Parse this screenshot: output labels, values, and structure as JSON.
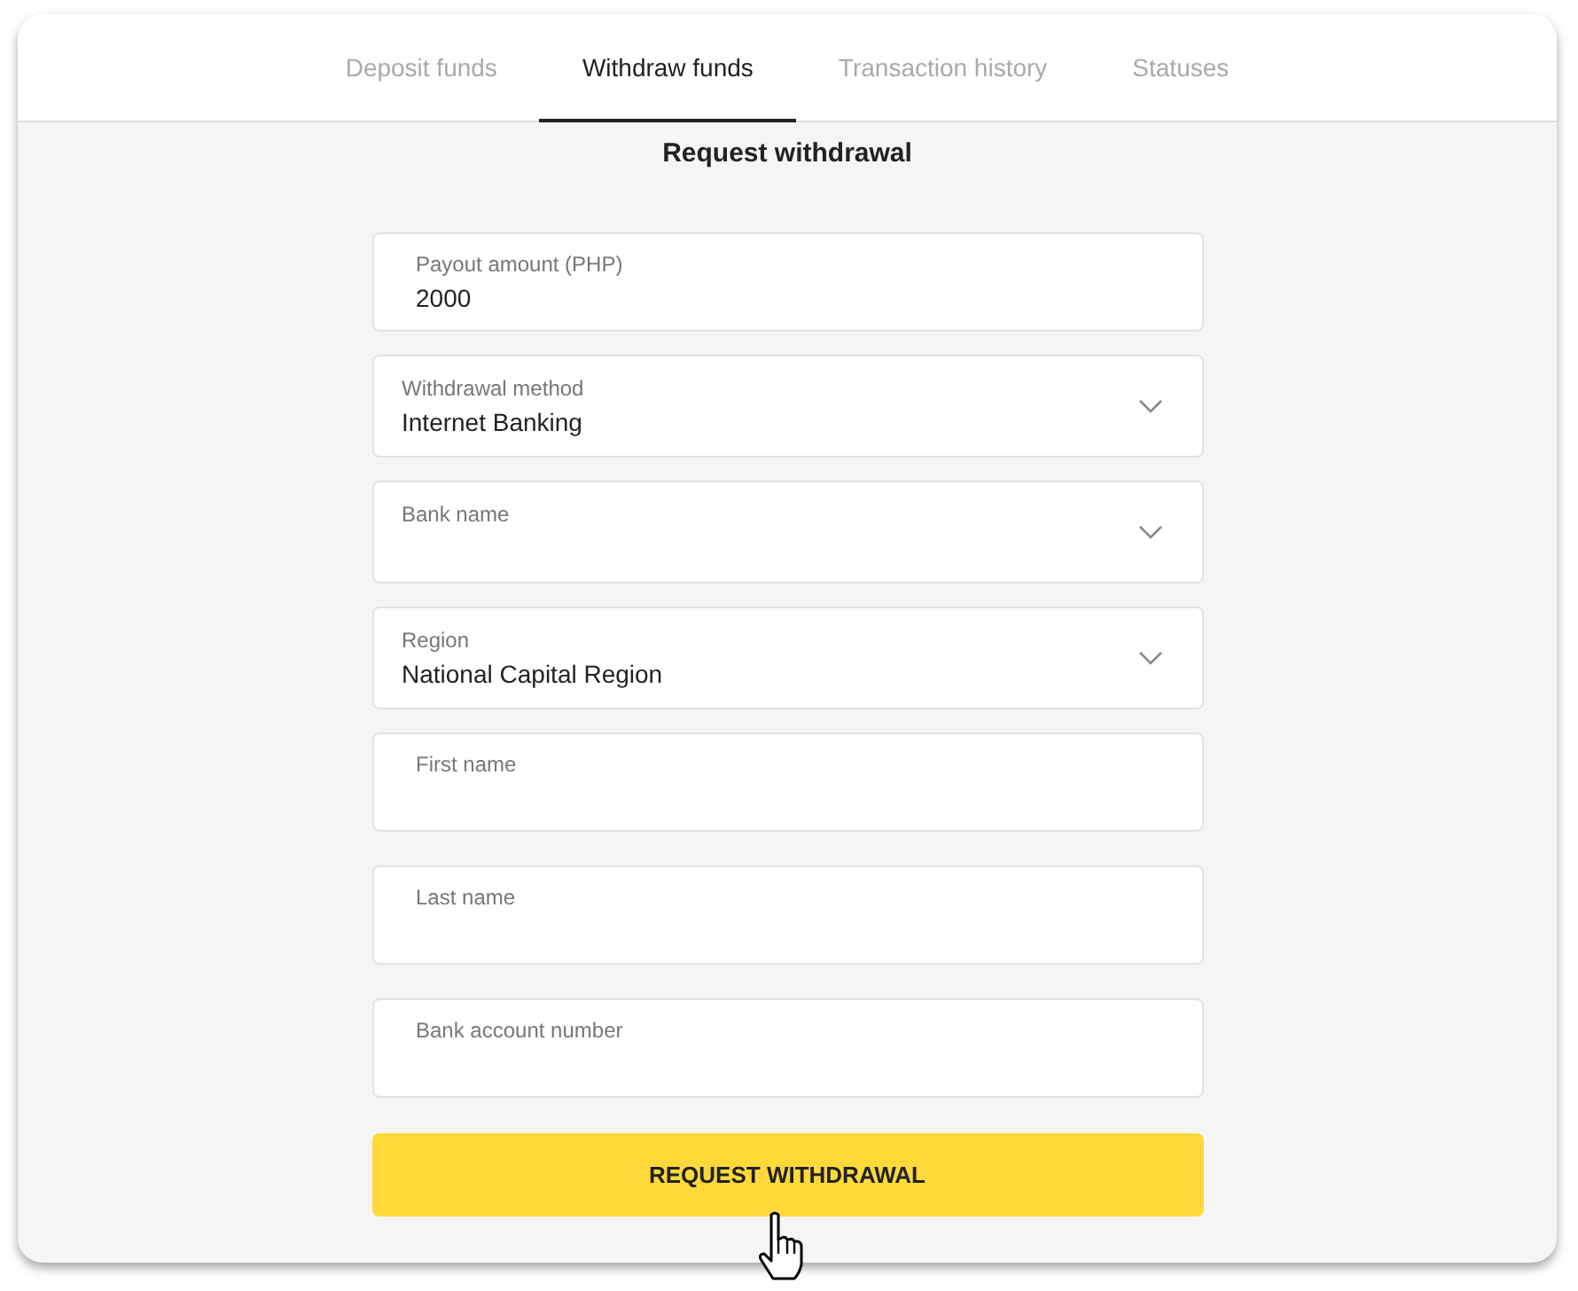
{
  "tabs": [
    {
      "label": "Deposit funds",
      "selected": false
    },
    {
      "label": "Withdraw funds",
      "selected": true
    },
    {
      "label": "Transaction history",
      "selected": false
    },
    {
      "label": "Statuses",
      "selected": false
    }
  ],
  "title": "Request withdrawal",
  "fields": [
    {
      "kind": "text",
      "label": "Payout amount (PHP)",
      "value": "2000"
    },
    {
      "kind": "select",
      "label": "Withdrawal method",
      "value": "Internet Banking"
    },
    {
      "kind": "select",
      "label": "Bank name"
    },
    {
      "kind": "select",
      "label": "Region",
      "value": "National Capital Region"
    },
    {
      "kind": "text",
      "label": "First name"
    },
    {
      "kind": "text",
      "label": "Last name"
    },
    {
      "kind": "text",
      "label": "Bank account number"
    }
  ],
  "submit": "REQUEST WITHDRAWAL"
}
